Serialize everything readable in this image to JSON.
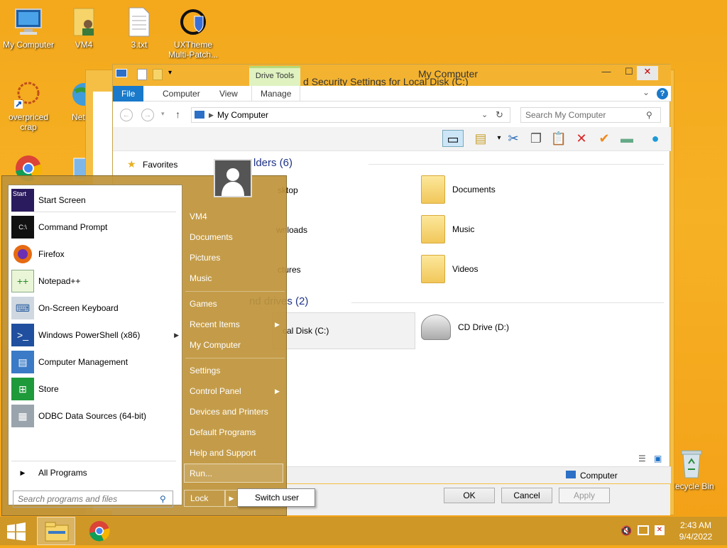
{
  "desktop": {
    "icons": [
      {
        "label": "My Computer"
      },
      {
        "label": "VM4"
      },
      {
        "label": "3.txt"
      },
      {
        "label": "UXTheme Multi-Patch..."
      },
      {
        "label": "overpriced crap"
      },
      {
        "label": "Netwo"
      },
      {
        "label": "Recycle Bin"
      }
    ]
  },
  "props_window": {
    "title": "Security Settings for Local Disk (C:)",
    "title_prefix": "d"
  },
  "explorer": {
    "title": "My Computer",
    "contextual_tab": "Drive Tools",
    "tabs": [
      "File",
      "Computer",
      "View",
      "Manage"
    ],
    "address": "My Computer",
    "search_placeholder": "Search My Computer",
    "nav_favorites": "Favorites",
    "folders_header": "lders (6)",
    "folders": [
      "sktop",
      "Documents",
      "wnloads",
      "Music",
      "ctures",
      "Videos"
    ],
    "drives_header": "nd drives (2)",
    "drives": [
      "cal Disk (C:)",
      "CD Drive (D:)"
    ],
    "status_computer": "Computer",
    "buttons": {
      "ok": "OK",
      "cancel": "Cancel",
      "apply": "Apply"
    }
  },
  "start_menu": {
    "pinned": [
      "Start Screen",
      "Command Prompt",
      "Firefox",
      "Notepad++",
      "On-Screen Keyboard",
      "Windows PowerShell (x86)",
      "Computer Management",
      "Store",
      "ODBC Data Sources (64-bit)"
    ],
    "start_tile_text": "Start",
    "all_programs": "All Programs",
    "search_placeholder": "Search programs and files",
    "right": [
      "VM4",
      "Documents",
      "Pictures",
      "Music",
      "Games",
      "Recent Items",
      "My Computer",
      "Settings",
      "Control Panel",
      "Devices and Printers",
      "Default Programs",
      "Help and Support",
      "Run..."
    ],
    "lock": "Lock",
    "switch_user": "Switch user"
  },
  "tray": {
    "time": "2:43 AM",
    "date": "9/4/2022"
  }
}
